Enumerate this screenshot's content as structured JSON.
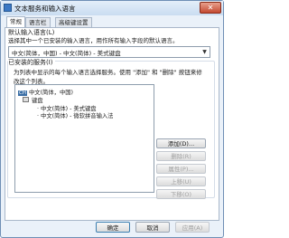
{
  "window": {
    "title": "文本服务和输入语言",
    "close_glyph": "✕"
  },
  "tabs": [
    {
      "label": "常规"
    },
    {
      "label": "语言栏"
    },
    {
      "label": "高级键设置"
    }
  ],
  "default_language": {
    "heading": "默认输入语言(L)",
    "description": "选择其中一个已安装的输入语言，用作所有输入字段的默认语言。",
    "selected": "中文(简体，中国) - 中文(简体) - 美式键盘"
  },
  "installed_services": {
    "heading": "已安装的服务(I)",
    "description": "为列表中显示的每个输入语言选择服务。使用 \"添加\" 和 \"删除\" 按钮来修改这个列表。",
    "tree": {
      "language": "中文(简体，中国)",
      "category": "键盘",
      "items": [
        "中文(简体) - 美式键盘",
        "中文(简体) - 微软拼音输入法"
      ]
    },
    "buttons": {
      "add": "添加(D)...",
      "remove": "删除(R)",
      "properties": "属性(P)...",
      "move_up": "上移(U)",
      "move_down": "下移(O)"
    }
  },
  "footer": {
    "ok": "确定",
    "cancel": "取消",
    "apply": "应用(A)"
  }
}
